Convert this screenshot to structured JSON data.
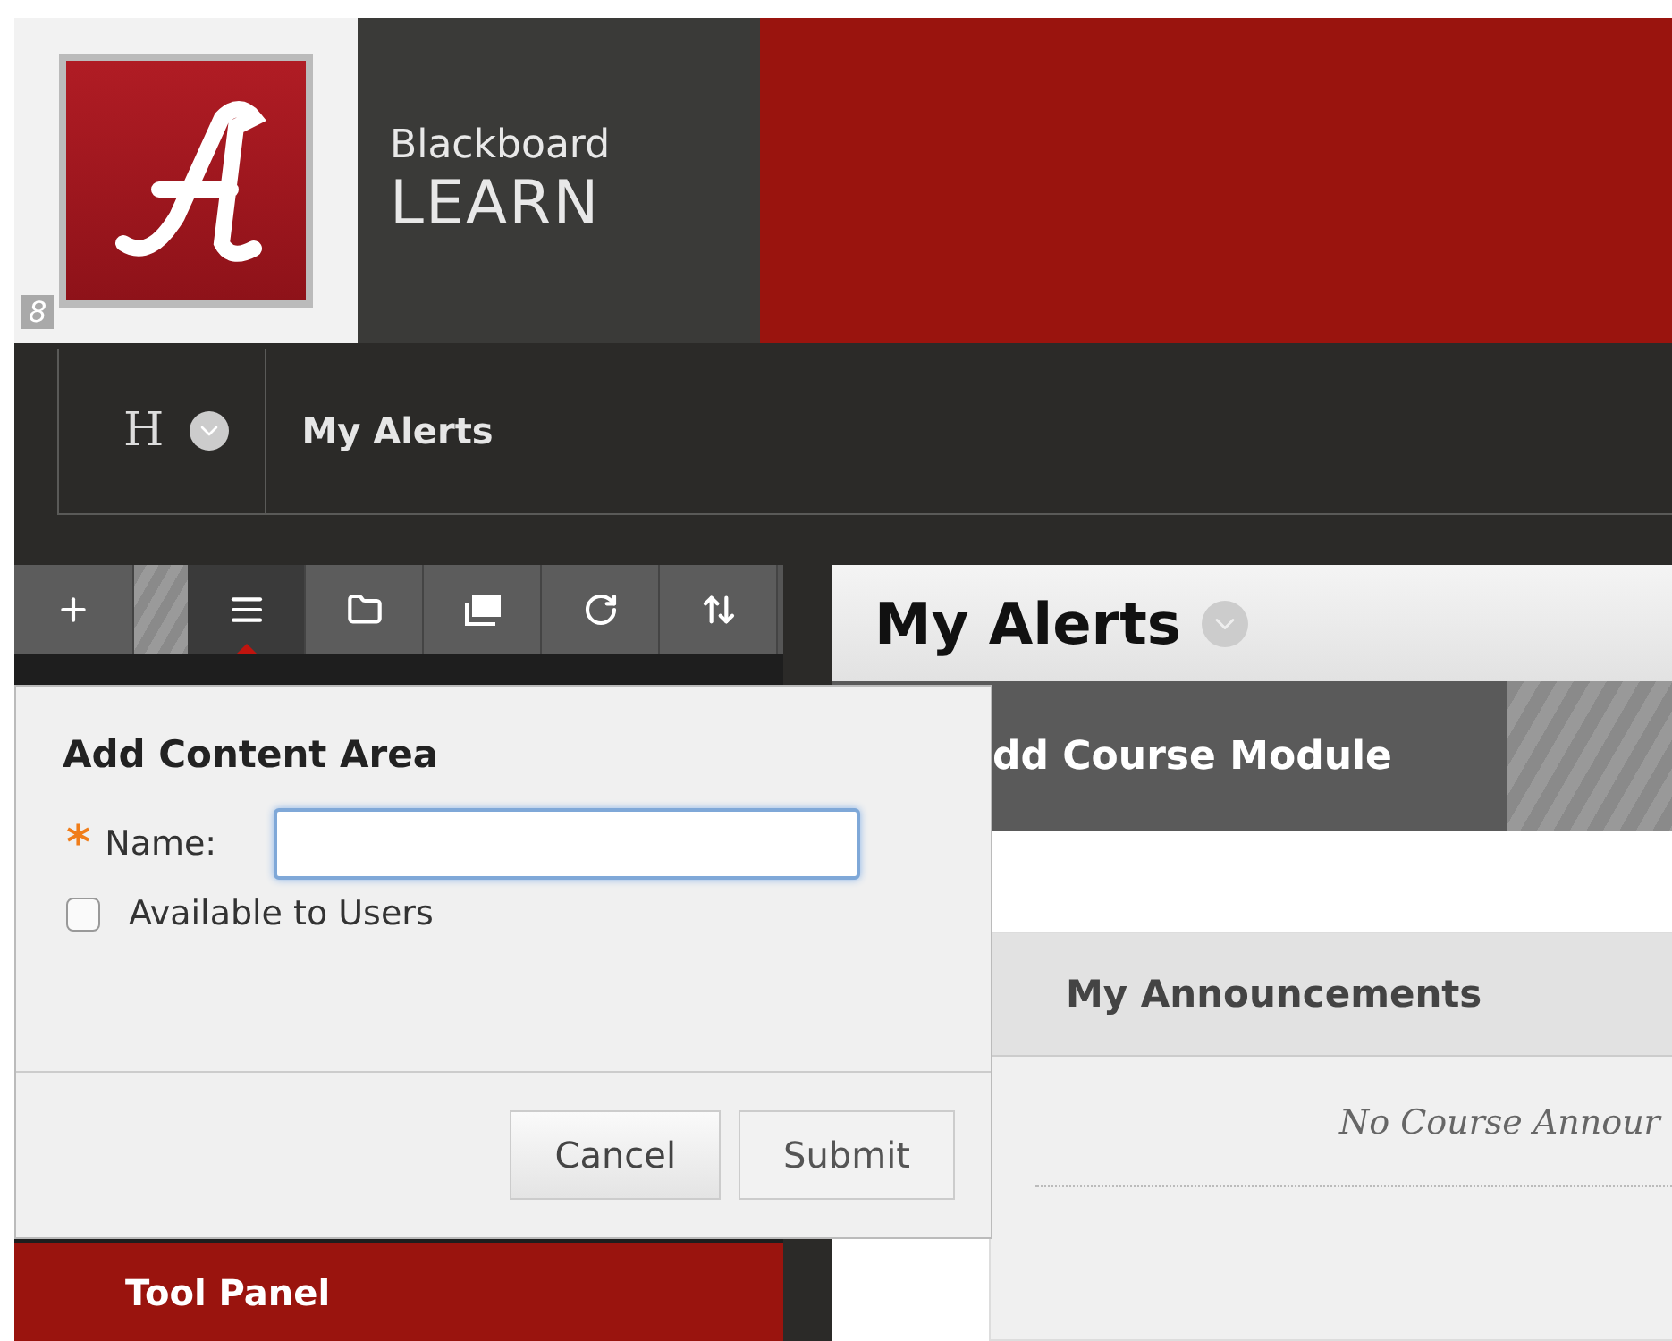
{
  "header": {
    "logo_text_top": "Blackboard",
    "logo_text_bottom": "LEARN",
    "corner_mark": "8"
  },
  "nav": {
    "home_letter": "H",
    "current": "My Alerts"
  },
  "toolbar": [
    {
      "selected": false
    },
    {
      "selected": true
    },
    {
      "selected": false
    },
    {
      "selected": false
    },
    {
      "selected": false
    },
    {
      "selected": false
    }
  ],
  "dialog": {
    "title": "Add Content Area",
    "required_mark": "*",
    "name_label": "Name:",
    "available_label": "Available to Users",
    "available_checked": false,
    "buttons": [
      "Cancel",
      "Submit"
    ]
  },
  "tool_panel": "Tool Panel",
  "main": {
    "title": "My Alerts",
    "add_module": "dd Course Module",
    "module": {
      "title": "My Announcements",
      "empty": "No Course Annour"
    }
  }
}
